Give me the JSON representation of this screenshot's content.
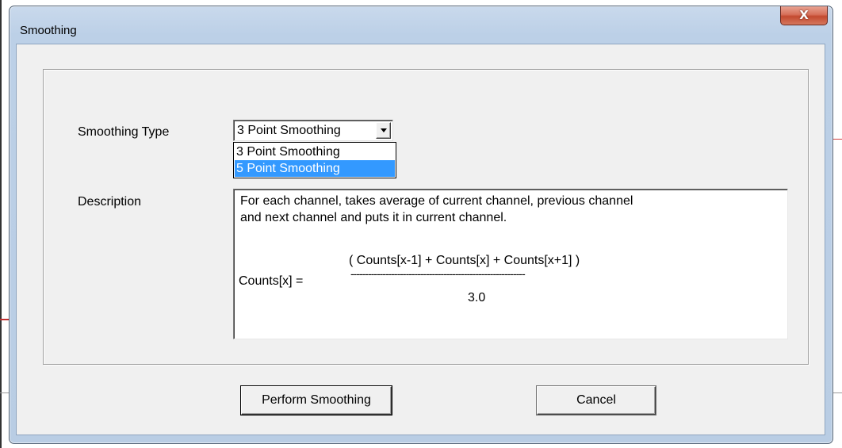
{
  "window": {
    "title": "Smoothing",
    "close_glyph": "X"
  },
  "form": {
    "smoothing_type_label": "Smoothing Type",
    "description_label": "Description"
  },
  "smoothing_type": {
    "selected": "3 Point Smoothing",
    "options": [
      "3 Point Smoothing",
      "5 Point Smoothing"
    ],
    "highlighted_index": 1
  },
  "description": {
    "line1": "For each channel, takes average of current channel, previous channel",
    "line2": "and next channel and puts it in current channel.",
    "formula_lhs": "Counts[x] =",
    "formula_numerator": "( Counts[x-1] + Counts[x] + Counts[x+1] )",
    "formula_bar": "------------------------------------------------------------",
    "formula_denominator": "3.0"
  },
  "buttons": {
    "perform": "Perform Smoothing",
    "cancel": "Cancel"
  },
  "colors": {
    "selection_highlight": "#3399ff",
    "close_button": "#c7503a",
    "frame": "#bcd0e7"
  }
}
